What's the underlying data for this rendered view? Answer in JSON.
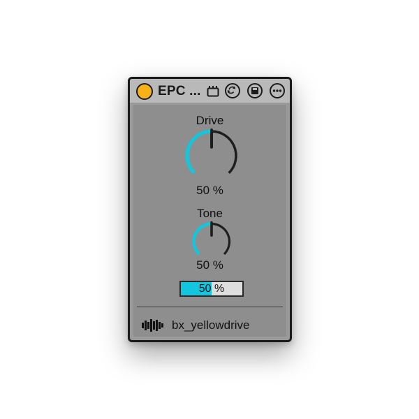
{
  "device": {
    "title": "EPC ...",
    "power_color": "#f7b21a",
    "accent_color": "#12c6dd",
    "header_icons": [
      "clip-icon",
      "refresh-icon",
      "save-icon",
      "more-icon"
    ]
  },
  "controls": {
    "drive": {
      "label": "Drive",
      "value_text": "50 %",
      "value": 0.5
    },
    "tone": {
      "label": "Tone",
      "value_text": "50 %",
      "value": 0.5
    },
    "mix_bar": {
      "value_text": "50 %",
      "value": 0.5
    }
  },
  "footer": {
    "device_name": "bx_yellowdrive",
    "icon": "waveform-icon"
  }
}
